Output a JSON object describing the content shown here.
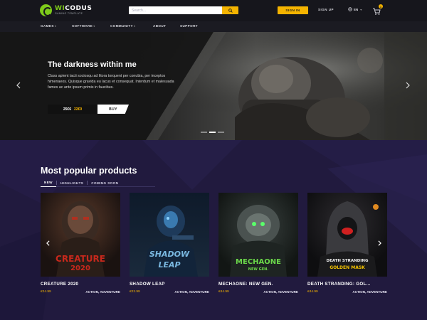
{
  "brand": {
    "name_accent": "WI",
    "name_rest": "CODUS",
    "tagline": "GAMING TEMPLATE"
  },
  "header": {
    "search_placeholder": "Search...",
    "signin_label": "SIGN IN",
    "signup_label": "SIGN UP",
    "language": "EN",
    "cart_count": "1"
  },
  "nav": {
    "items": [
      {
        "label": "GAMES",
        "dropdown": true
      },
      {
        "label": "SOFTWARE",
        "dropdown": true
      },
      {
        "label": "COMMUNITY",
        "dropdown": true
      },
      {
        "label": "ABOUT",
        "dropdown": false
      },
      {
        "label": "SUPPORT",
        "dropdown": false
      }
    ]
  },
  "hero": {
    "title": "The darkness within me",
    "description": "Class aptent tacti sociosqu ad litora torquent per conubia, per inceptos himenaeos. Quisque gravida eu lacus et consequat. Interdum et malesuada fames ac ante ipsum primis in faucibus.",
    "price_new": "25€6",
    "price_old": "22€9",
    "buy_label": "BUY",
    "slides_total": 3,
    "slide_active": 1
  },
  "products": {
    "title": "Most popular products",
    "tabs": [
      "NEW",
      "HIGHLIGHTS",
      "COMING SOON"
    ],
    "active_tab": "NEW",
    "items": [
      {
        "title": "CREATURE 2020",
        "price": "€24.99",
        "genre": "ACTION, ADVENTURE",
        "cover_line1": "CREATURE",
        "cover_line2": "2020"
      },
      {
        "title": "SHADOW LEAP",
        "price": "€22.99",
        "genre": "ACTION, ADVENTURE",
        "cover_line1": "SHADOW",
        "cover_line2": "LEAP"
      },
      {
        "title": "MECHAONE: NEW GEN.",
        "price": "€44.99",
        "genre": "ACTION, ADVENTURE",
        "cover_line1": "MECHAONE",
        "cover_line2": "NEW GEN."
      },
      {
        "title": "DEATH STRANDING: GOL...",
        "price": "€44.99",
        "genre": "ACTION, ADVENTURE",
        "cover_line1": "DEATH STRANDING",
        "cover_line2": "GOLDEN MASK"
      }
    ]
  },
  "colors": {
    "accent": "#f5b400",
    "logo_green": "#7ecb1a",
    "section_bg": "#221a3f",
    "topbar_bg": "#16161c"
  },
  "icons": [
    "search-icon",
    "globe-icon",
    "cart-icon",
    "chevron-left-icon",
    "chevron-right-icon"
  ]
}
